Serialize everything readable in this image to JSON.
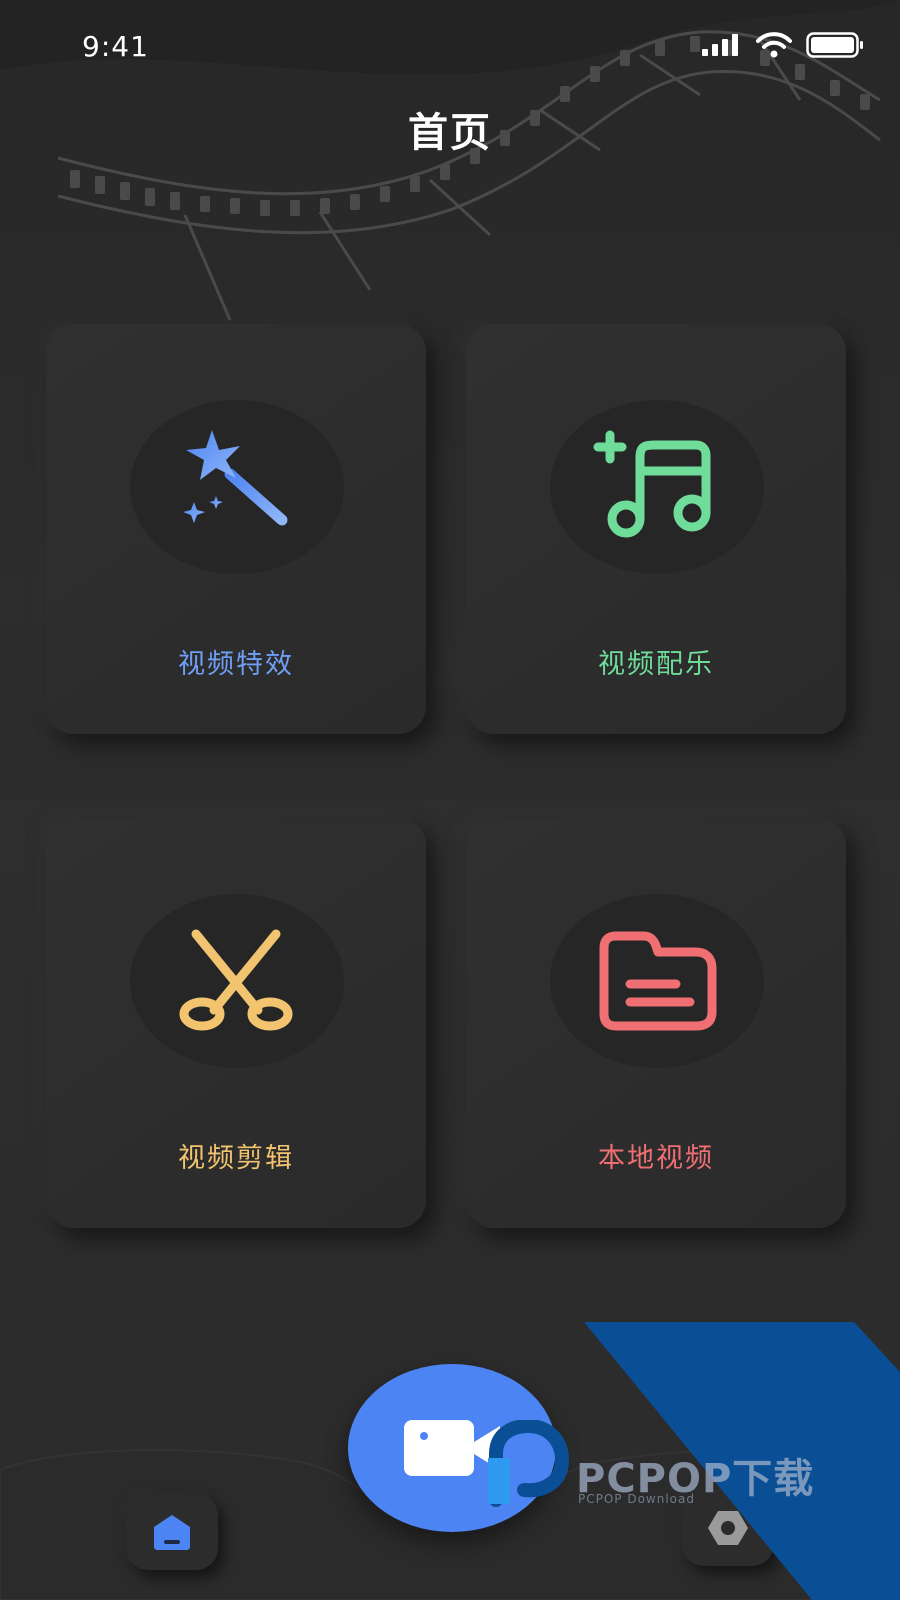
{
  "status_bar": {
    "time": "9:41",
    "icons": [
      "signal-icon",
      "wifi-icon",
      "battery-icon"
    ]
  },
  "header": {
    "title": "首页"
  },
  "cards": [
    {
      "label": "视频特效",
      "icon": "magic-wand-icon",
      "color": "#6f9ff5"
    },
    {
      "label": "视频配乐",
      "icon": "music-add-icon",
      "color": "#6fdc9a"
    },
    {
      "label": "视频剪辑",
      "icon": "scissors-icon",
      "color": "#f2c46f"
    },
    {
      "label": "本地视频",
      "icon": "folder-icon",
      "color": "#ef6f72"
    }
  ],
  "bottom_nav": {
    "items": [
      {
        "icon": "home-icon",
        "active": true,
        "color": "#4d84f3"
      },
      {
        "icon": "settings-icon",
        "active": false,
        "color": "#9a9a9a"
      }
    ],
    "record_button": {
      "icon": "video-camera-icon",
      "color": "#4d84f3"
    }
  },
  "watermark": {
    "text": "PCPOP下载",
    "subtext": "PCPOP Download",
    "color": "#0a4f96"
  }
}
